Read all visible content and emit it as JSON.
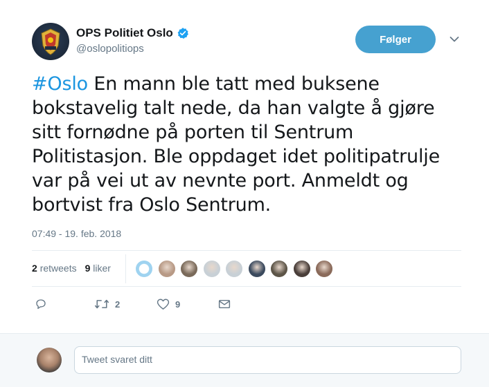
{
  "account": {
    "name": "OPS Politiet Oslo",
    "handle": "@oslopolitiops",
    "verified": true
  },
  "follow_button": {
    "label": "Følger"
  },
  "tweet": {
    "hashtag": "#Oslo",
    "text": " En mann ble tatt med buksene bokstavelig talt nede, da han valgte å gjøre sitt fornødne på porten til Sentrum Politistasjon. Ble oppdaget idet politipatrulje var på vei ut av nevnte port. Anmeldt og bortvist fra Oslo Sentrum.",
    "timestamp": "07:49 - 19. feb. 2018"
  },
  "stats": {
    "retweets_count": "2",
    "retweets_label": "retweets",
    "likes_count": "9",
    "likes_label": "liker"
  },
  "likers": [
    {
      "color": "#9fd3f0"
    },
    {
      "color": "#b89a86"
    },
    {
      "color": "#7a6a5a"
    },
    {
      "color": "#c8d0d6"
    },
    {
      "color": "#c8d0d6"
    },
    {
      "color": "#3b4a5e"
    },
    {
      "color": "#5d5548"
    },
    {
      "color": "#4a3f3a"
    },
    {
      "color": "#8a6a5a"
    }
  ],
  "actions": {
    "reply_icon": "reply-icon",
    "retweet_icon": "retweet-icon",
    "retweet_count": "2",
    "like_icon": "heart-icon",
    "like_count": "9",
    "dm_icon": "envelope-icon"
  },
  "reply": {
    "placeholder": "Tweet svaret ditt"
  },
  "colors": {
    "accent": "#1b95e0",
    "follow_bg": "#46a1d0",
    "muted": "#657786"
  }
}
